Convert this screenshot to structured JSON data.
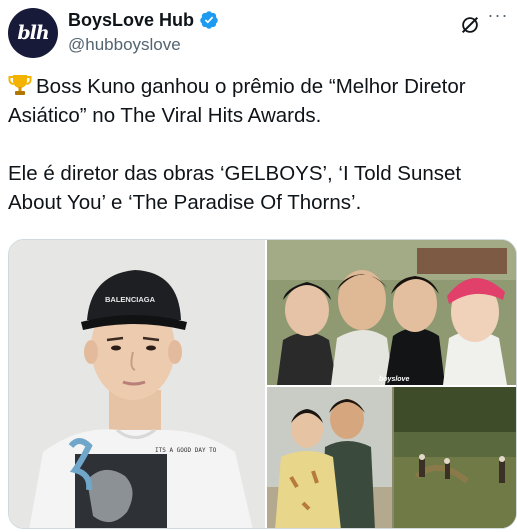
{
  "account": {
    "display_name": "BoysLove Hub",
    "handle": "@hubboyslove",
    "avatar_text": "blh",
    "verified": true
  },
  "tweet": {
    "line1": "Boss Kuno ganhou o prêmio de “Melhor Diretor Asiático” no The Viral Hits Awards.",
    "line2": "Ele é diretor das obras ‘GELBOYS’, ‘I Told Sunset About You’ e ‘The Paradise Of Thorns’."
  },
  "media": {
    "photo1": {
      "cap_text": "BALENCIAGA",
      "shirt_text": "ITS A GOOD DAY TO"
    },
    "photo2": {
      "watermark": "boyslove"
    }
  },
  "colors": {
    "verified_blue": "#1d9bf0",
    "avatar_bg": "#181a3a",
    "secondary_text": "#536471"
  },
  "icons": {
    "verified": "verified-badge-icon",
    "grok": "grok-icon",
    "more": "more-icon",
    "trophy": "trophy-icon"
  }
}
